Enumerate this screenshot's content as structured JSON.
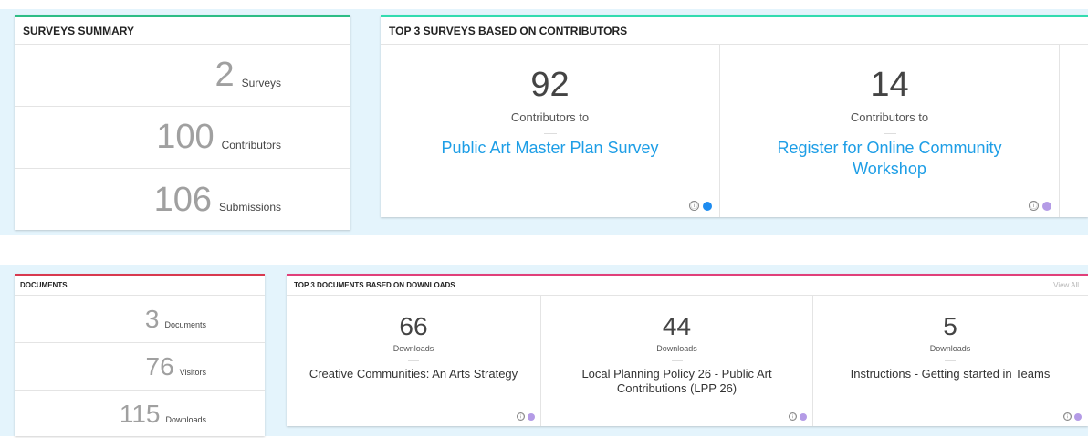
{
  "surveys_summary": {
    "title": "SURVEYS SUMMARY",
    "stats": [
      {
        "value": "2",
        "label": "Surveys"
      },
      {
        "value": "100",
        "label": "Contributors"
      },
      {
        "value": "106",
        "label": "Submissions"
      }
    ]
  },
  "top_surveys": {
    "title": "TOP 3 SURVEYS BASED ON CONTRIBUTORS",
    "items": [
      {
        "count": "92",
        "caption": "Contributors to",
        "title": "Public Art Master Plan Survey",
        "dot_color": "#1e8cf0"
      },
      {
        "count": "14",
        "caption": "Contributors to",
        "title": "Register for Online Community Workshop",
        "dot_color": "#b49be6"
      }
    ],
    "info_glyph": "ⓘ"
  },
  "documents_summary": {
    "title": "DOCUMENTS",
    "stats": [
      {
        "value": "3",
        "label": "Documents"
      },
      {
        "value": "76",
        "label": "Visitors"
      },
      {
        "value": "115",
        "label": "Downloads"
      }
    ]
  },
  "top_documents": {
    "title": "TOP 3 DOCUMENTS BASED ON DOWNLOADS",
    "view_all": "View All",
    "items": [
      {
        "count": "66",
        "caption": "Downloads",
        "title": "Creative Communities: An Arts Strategy",
        "dot_color": "#b49be6"
      },
      {
        "count": "44",
        "caption": "Downloads",
        "title": "Local Planning Policy 26 - Public Art Contributions (LPP 26)",
        "dot_color": "#b49be6"
      },
      {
        "count": "5",
        "caption": "Downloads",
        "title": "Instructions - Getting started in Teams",
        "dot_color": "#b49be6"
      }
    ],
    "info_glyph": "ⓘ"
  },
  "colors": {
    "background_band": "#e4f4fc",
    "surveys_accent": "#2ebd86",
    "documents_accent": "#d8394f",
    "link": "#1e9ee6"
  }
}
